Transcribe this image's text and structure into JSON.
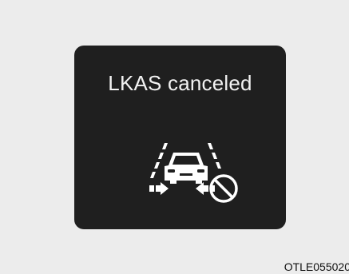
{
  "display": {
    "message": "LKAS canceled",
    "icon": "lkas-canceled-icon",
    "colors": {
      "background": "#ececec",
      "panel": "#1f1f1f",
      "text": "#f2f2f2"
    }
  },
  "figure_code": "OTLE055020"
}
